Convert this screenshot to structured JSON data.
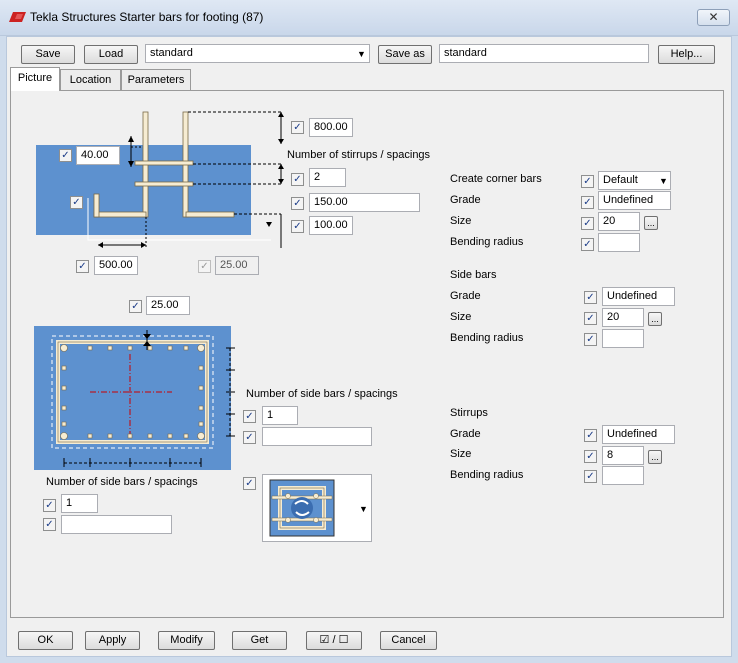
{
  "window": {
    "title": "Tekla Structures  Starter bars for footing (87)",
    "close_glyph": "✕",
    "accent": "#cc2222"
  },
  "toolbar": {
    "save_label": "Save",
    "load_label": "Load",
    "load_value": "standard",
    "save_as_label": "Save as",
    "save_as_value": "standard",
    "help_label": "Help..."
  },
  "tabs": [
    {
      "label": "Picture",
      "active": true
    },
    {
      "label": "Location",
      "active": false
    },
    {
      "label": "Parameters",
      "active": false
    }
  ],
  "section_view": {
    "top_value": "800.00",
    "cover_value": "40.00",
    "stirrups_label": "Number of stirrups / spacings",
    "stirrup_count": "2",
    "stirrup_spacing_1": "150.00",
    "stirrup_spacing_2": "100.00",
    "bottom_value": "500.00",
    "bottom_value_2": "25.00"
  },
  "plan_view": {
    "cover_value": "25.00",
    "right_side_label": "Number of side bars / spacings",
    "right_side_count": "1",
    "right_side_spacing": "",
    "bottom_side_label": "Number of side bars / spacings",
    "bottom_side_count": "1",
    "bottom_side_spacing": ""
  },
  "corner_bars": {
    "create_label": "Create corner bars",
    "create_value": "Default",
    "grade_label": "Grade",
    "grade_value": "Undefined",
    "size_label": "Size",
    "size_value": "20",
    "bending_label": "Bending radius",
    "bending_value": ""
  },
  "side_bars": {
    "header": "Side bars",
    "grade_label": "Grade",
    "grade_value": "Undefined",
    "size_label": "Size",
    "size_value": "20",
    "bending_label": "Bending radius",
    "bending_value": ""
  },
  "stirrups": {
    "header": "Stirrups",
    "grade_label": "Grade",
    "grade_value": "Undefined",
    "size_label": "Size",
    "size_value": "8",
    "bending_label": "Bending radius",
    "bending_value": ""
  },
  "browse_glyph": "...",
  "footer": {
    "ok_label": "OK",
    "apply_label": "Apply",
    "modify_label": "Modify",
    "get_label": "Get",
    "toggle_label": "☑ / ☐",
    "cancel_label": "Cancel"
  },
  "colors": {
    "diagram_blue": "#5d91cf",
    "bar_fill": "#f6ecd2",
    "bar_stroke": "#7a6a48"
  }
}
